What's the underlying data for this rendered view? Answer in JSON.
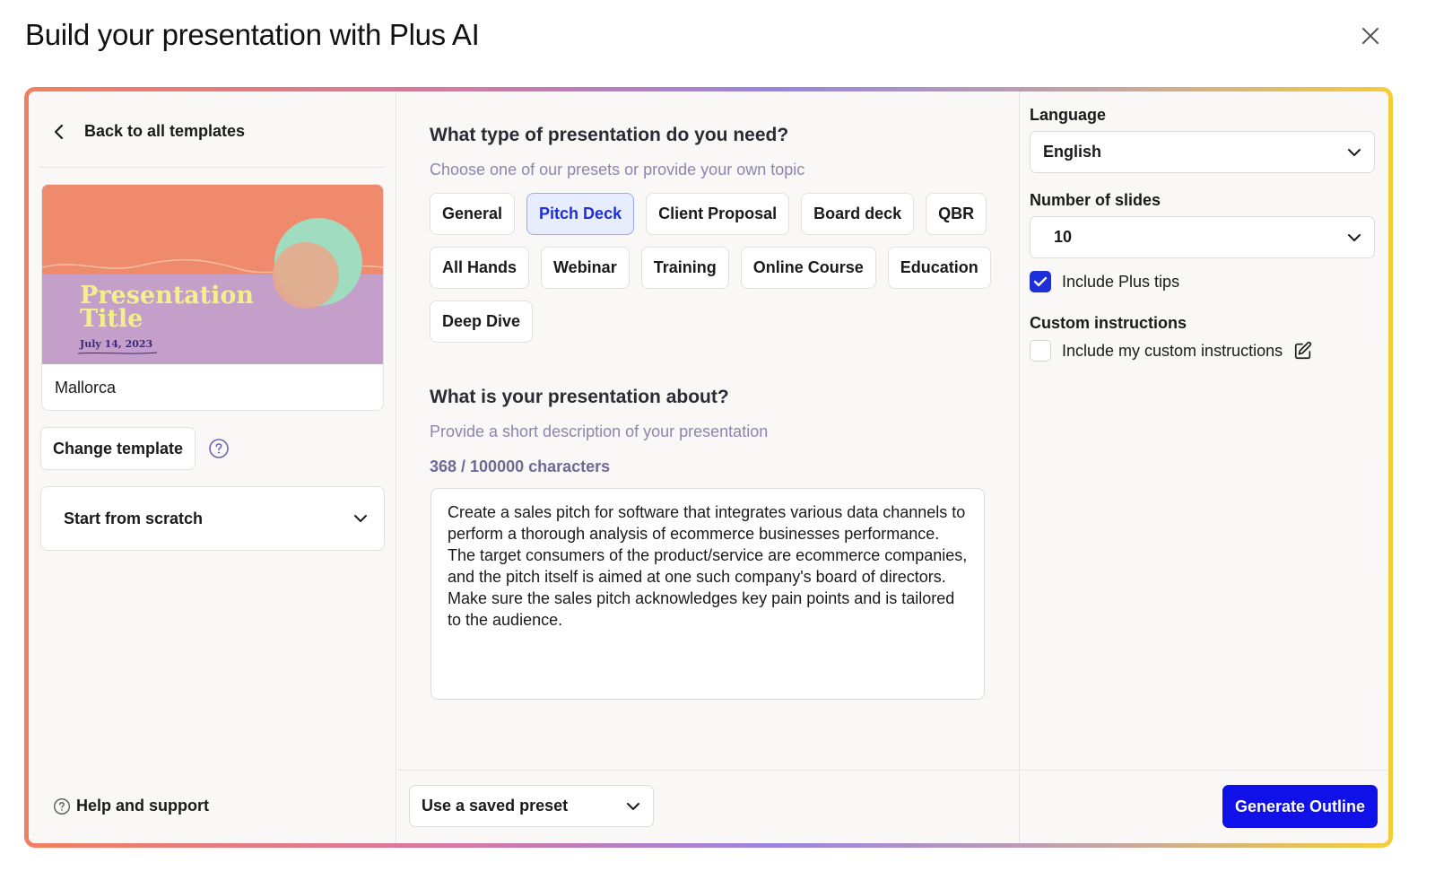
{
  "dialog": {
    "title": "Build your presentation with Plus AI"
  },
  "left": {
    "back_label": "Back to all templates",
    "template": {
      "name": "Mallorca",
      "thumb_title_line1": "Presentation",
      "thumb_title_line2": "Title",
      "thumb_date": "July 14, 2023"
    },
    "change_template_label": "Change template",
    "start_from_scratch_label": "Start from scratch",
    "help_support_label": "Help and support"
  },
  "main": {
    "type_question": "What type of presentation do you need?",
    "type_hint": "Choose one of our presets or provide your own topic",
    "presets": [
      "General",
      "Pitch Deck",
      "Client Proposal",
      "Board deck",
      "QBR",
      "All Hands",
      "Webinar",
      "Training",
      "Online Course",
      "Education",
      "Deep Dive"
    ],
    "selected_preset": "Pitch Deck",
    "about_question": "What is your presentation about?",
    "about_hint": "Provide a short description of your presentation",
    "char_count": "368 / 100000 characters",
    "description": "Create a sales pitch for software that integrates various data channels to perform a thorough analysis of ecommerce businesses performance. The target consumers of the product/service are ecommerce companies, and the pitch itself is aimed at one such company's board of directors. Make sure the sales pitch acknowledges key pain points and is tailored to the audience.",
    "saved_preset_label": "Use a saved preset"
  },
  "settings": {
    "language_label": "Language",
    "language_value": "English",
    "slides_label": "Number of slides",
    "slides_value": "10",
    "include_tips_label": "Include Plus tips",
    "include_tips_checked": true,
    "custom_instructions_label": "Custom instructions",
    "include_custom_label": "Include my custom instructions",
    "include_custom_checked": false,
    "generate_label": "Generate Outline"
  },
  "colors": {
    "accent": "#1010e8",
    "chip_active_bg": "#e7ecff",
    "hint_text": "#8b86b0"
  }
}
